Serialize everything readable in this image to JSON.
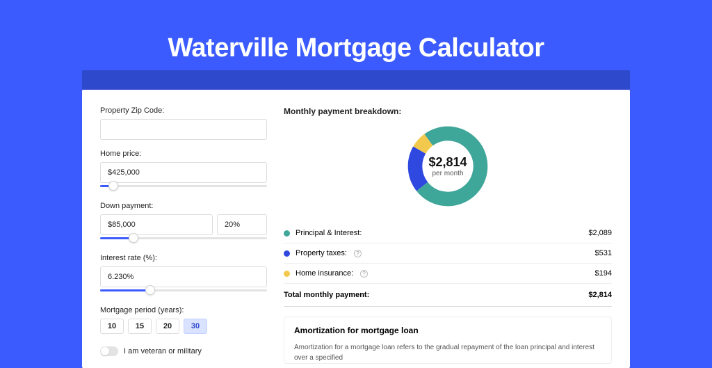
{
  "hero": {
    "title": "Waterville Mortgage Calculator"
  },
  "form": {
    "zip_label": "Property Zip Code:",
    "zip_value": "",
    "home_price_label": "Home price:",
    "home_price_value": "$425,000",
    "home_price_fill_pct": 8,
    "down_payment_label": "Down payment:",
    "down_payment_value": "$85,000",
    "down_payment_pct": "20%",
    "down_payment_fill_pct": 20,
    "interest_label": "Interest rate (%):",
    "interest_value": "6.230%",
    "interest_fill_pct": 30,
    "period_label": "Mortgage period (years):",
    "periods": [
      "10",
      "15",
      "20",
      "30"
    ],
    "period_active_index": 3,
    "veteran_label": "I am veteran or military"
  },
  "breakdown": {
    "title": "Monthly payment breakdown:",
    "center_amount": "$2,814",
    "center_sub": "per month",
    "items": [
      {
        "label": "Principal & Interest:",
        "value": "$2,089",
        "color": "#3FA69A",
        "has_help": false
      },
      {
        "label": "Property taxes:",
        "value": "$531",
        "color": "#2F49E0",
        "has_help": true
      },
      {
        "label": "Home insurance:",
        "value": "$194",
        "color": "#F2C94C",
        "has_help": true
      }
    ],
    "total_label": "Total monthly payment:",
    "total_value": "$2,814"
  },
  "chart_data": {
    "type": "pie",
    "title": "Monthly payment breakdown",
    "series": [
      {
        "name": "Principal & Interest",
        "value": 2089,
        "color": "#3FA69A"
      },
      {
        "name": "Property taxes",
        "value": 531,
        "color": "#2F49E0"
      },
      {
        "name": "Home insurance",
        "value": 194,
        "color": "#F2C94C"
      }
    ],
    "total": 2814,
    "center_label": "$2,814 per month"
  },
  "amort": {
    "title": "Amortization for mortgage loan",
    "text": "Amortization for a mortgage loan refers to the gradual repayment of the loan principal and interest over a specified"
  }
}
